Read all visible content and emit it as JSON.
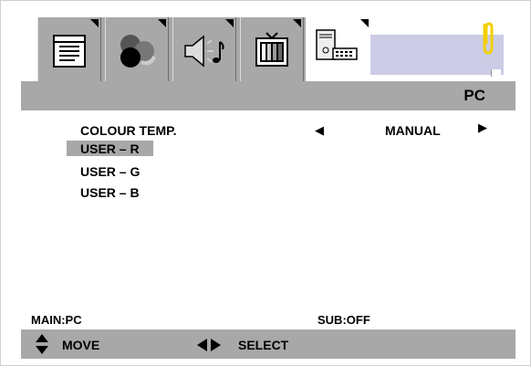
{
  "tabs": [
    {
      "name": "picture",
      "icon": "picture-icon"
    },
    {
      "name": "colour",
      "icon": "colour-balls-icon"
    },
    {
      "name": "sound",
      "icon": "speaker-icon"
    },
    {
      "name": "tv",
      "icon": "tv-icon"
    },
    {
      "name": "pc",
      "icon": "pc-icon",
      "active": true
    }
  ],
  "header": {
    "title": "PC"
  },
  "menu": {
    "colour_temp_label": "COLOUR  TEMP.",
    "colour_temp_value": "MANUAL",
    "items": [
      "USER – R",
      "USER – G",
      "USER – B"
    ],
    "selected_index": 0
  },
  "status": {
    "main": "MAIN:PC",
    "sub": "SUB:OFF"
  },
  "hints": {
    "move": "MOVE",
    "select": "SELECT"
  },
  "colors": {
    "bar": "#a8a8a8",
    "extra_panel": "#cccce6",
    "clip": "#f2d000"
  }
}
